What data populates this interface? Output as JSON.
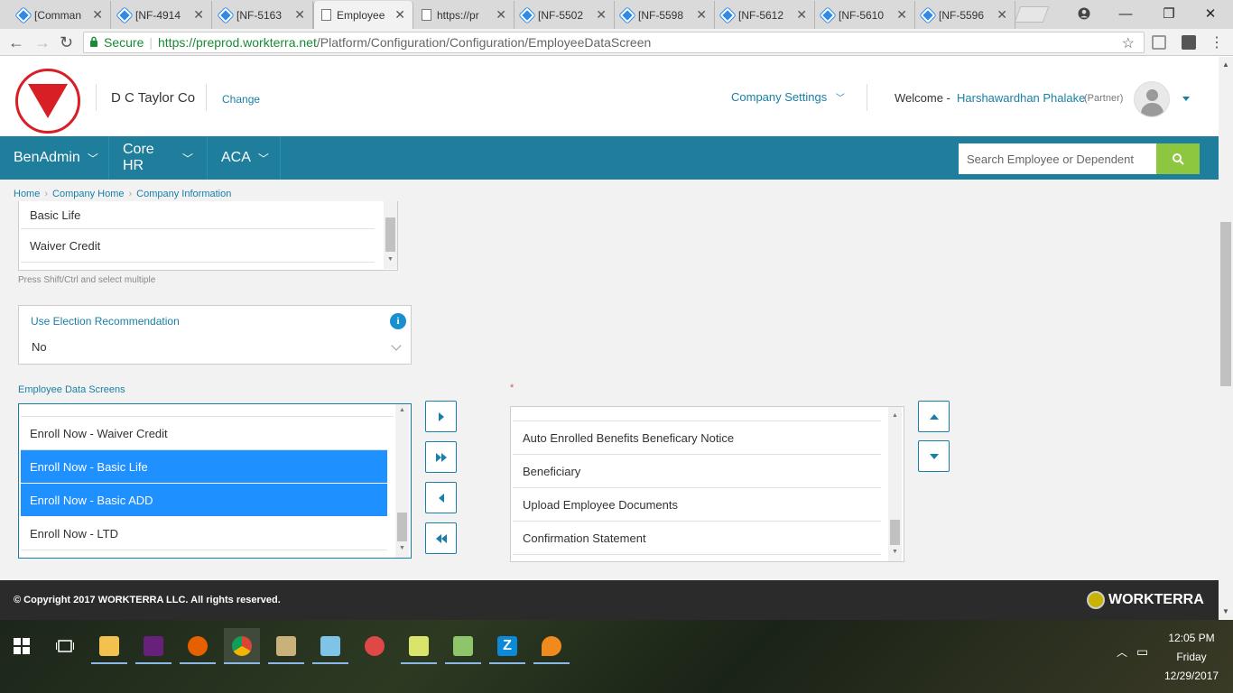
{
  "browser": {
    "tabs": [
      {
        "title": "[Comman",
        "icon": "jira-icon"
      },
      {
        "title": "[NF-4914",
        "icon": "jira-icon"
      },
      {
        "title": "[NF-5163",
        "icon": "jira-icon"
      },
      {
        "title": "Employee",
        "icon": "page-icon",
        "active": true
      },
      {
        "title": "https://pr",
        "icon": "page-icon"
      },
      {
        "title": "[NF-5502",
        "icon": "jira-icon"
      },
      {
        "title": "[NF-5598",
        "icon": "jira-icon"
      },
      {
        "title": "[NF-5612",
        "icon": "jira-icon"
      },
      {
        "title": "[NF-5610",
        "icon": "jira-icon"
      },
      {
        "title": "[NF-5596",
        "icon": "jira-icon"
      }
    ],
    "secure_label": "Secure",
    "url_host": "https://preprod.workterra.net",
    "url_path": "/Platform/Configuration/Configuration/EmployeeDataScreen"
  },
  "header": {
    "company": "D C Taylor Co",
    "change_link": "Change",
    "company_settings": "Company Settings",
    "welcome": "Welcome -",
    "user_name": "Harshawardhan Phalake",
    "user_role": "(Partner)",
    "logo_text": "D.C. TAYLOR CO."
  },
  "nav": {
    "menus": [
      "BenAdmin",
      "Core HR",
      "ACA"
    ],
    "search_placeholder": "Search Employee or Dependent"
  },
  "breadcrumb": [
    "Home",
    "Company Home",
    "Company Information"
  ],
  "top_list": {
    "items": [
      "Basic Life",
      "Waiver Credit"
    ],
    "hint": "Press Shift/Ctrl and select multiple"
  },
  "election": {
    "label": "Use Election Recommendation",
    "value": "No"
  },
  "eds": {
    "label": "Employee Data Screens",
    "required_mark": "*",
    "available": [
      {
        "label": "Enroll Now - Waiver Credit",
        "selected": false
      },
      {
        "label": "Enroll Now - Basic Life",
        "selected": true
      },
      {
        "label": "Enroll Now - Basic ADD",
        "selected": true
      },
      {
        "label": "Enroll Now - LTD",
        "selected": false
      }
    ],
    "chosen": [
      "Auto Enrolled Benefits Beneficary Notice",
      "Beneficiary",
      "Upload Employee Documents",
      "Confirmation Statement"
    ]
  },
  "footer": {
    "copyright": "© Copyright 2017 WORKTERRA LLC. All rights reserved.",
    "brand": "WORKTERRA"
  },
  "taskbar": {
    "time": "12:05 PM",
    "day": "Friday",
    "date": "12/29/2017"
  }
}
